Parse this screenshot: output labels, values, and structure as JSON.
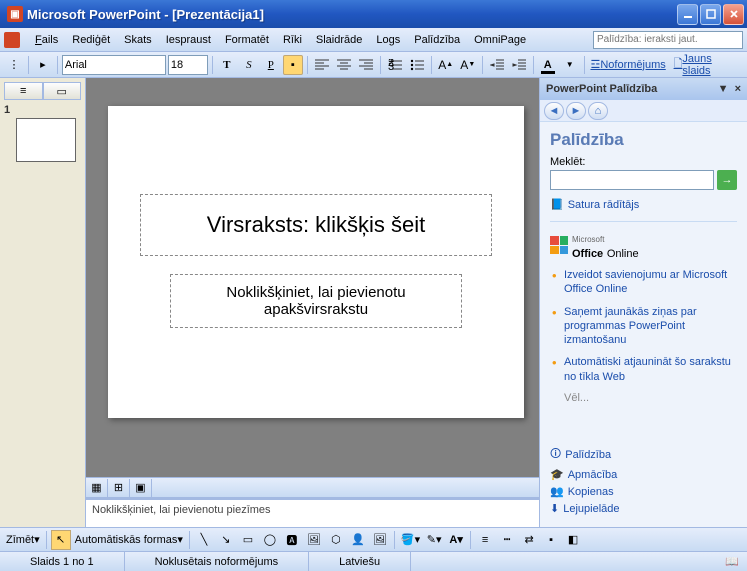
{
  "title": "Microsoft PowerPoint - [Prezentācija1]",
  "menu": {
    "fails": "Fails",
    "rediget": "Rediģēt",
    "skats": "Skats",
    "iespraust": "Iespraust",
    "formatet": "Formatēt",
    "riki": "Rīki",
    "slaidrade": "Slaidrāde",
    "logs": "Logs",
    "palidziba": "Palīdzība",
    "omnipage": "OmniPage"
  },
  "help_placeholder": "Palīdzība: ieraksti jaut.",
  "toolbar": {
    "font": "Arial",
    "size": "18",
    "noformejums": "Noformējums",
    "jauns_slaids": "Jauns slaids"
  },
  "thumbs": {
    "slide_num": "1"
  },
  "slide": {
    "title_ph": "Virsraksts: klikšķis šeit",
    "subtitle_ph": "Noklikšķiniet, lai pievienotu apakšvirsrakstu"
  },
  "notes_ph": "Noklikšķiniet, lai pievienotu piezīmes",
  "taskpane": {
    "title": "PowerPoint Palīdzība",
    "heading": "Palīdzība",
    "search_label": "Meklēt:",
    "toc": "Satura rādītājs",
    "office_ms": "Microsoft",
    "office_brand": "Office",
    "office_online": "Online",
    "bullets": [
      "Izveidot savienojumu ar Microsoft Office Online",
      "Saņemt jaunākās ziņas par programmas PowerPoint izmantošanu",
      "Automātiski atjaunināt šo sarakstu no tīkla Web"
    ],
    "more": "Vēl...",
    "links": {
      "palidziba": "Palīdzība",
      "apmaciba": "Apmācība",
      "kopienas": "Kopienas",
      "lejupielade": "Lejupielāde"
    }
  },
  "draw": {
    "zimet": "Zīmēt",
    "autoshapes": "Automātiskās formas"
  },
  "status": {
    "slide": "Slaids 1 no 1",
    "layout": "Noklusētais noformējums",
    "lang": "Latviešu"
  }
}
